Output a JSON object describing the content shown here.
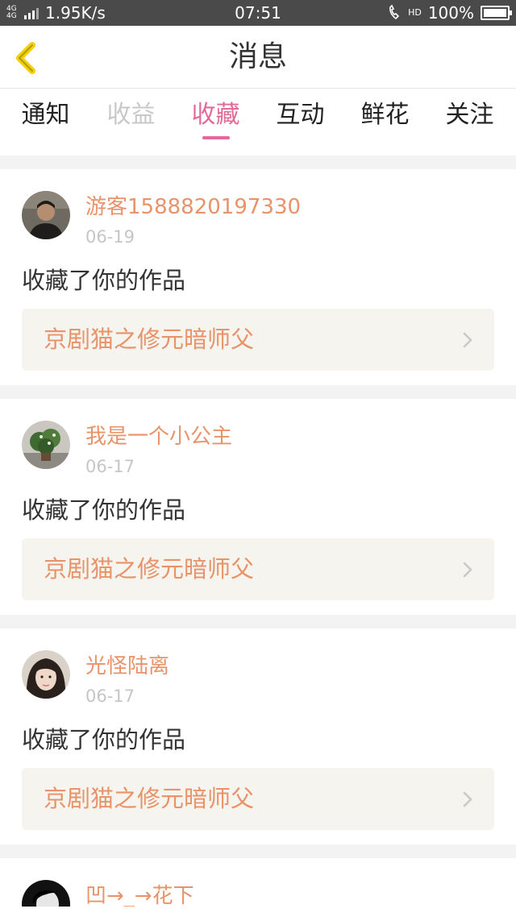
{
  "status_bar": {
    "network_type": "4G 4G",
    "speed": "1.95K/s",
    "time": "07:51",
    "hd_call": "HD",
    "battery": "100%"
  },
  "header": {
    "title": "消息"
  },
  "tabs": [
    {
      "label": "通知",
      "state": "normal"
    },
    {
      "label": "收益",
      "state": "muted"
    },
    {
      "label": "收藏",
      "state": "active"
    },
    {
      "label": "互动",
      "state": "normal"
    },
    {
      "label": "鲜花",
      "state": "normal"
    },
    {
      "label": "关注",
      "state": "normal"
    }
  ],
  "items": [
    {
      "username": "游客1588820197330",
      "date": "06-19",
      "action": "收藏了你的作品",
      "work": "京剧猫之修元暗师父",
      "avatar": "man-dark"
    },
    {
      "username": "我是一个小公主",
      "date": "06-17",
      "action": "收藏了你的作品",
      "work": "京剧猫之修元暗师父",
      "avatar": "plant"
    },
    {
      "username": "光怪陆离",
      "date": "06-17",
      "action": "收藏了你的作品",
      "work": "京剧猫之修元暗师父",
      "avatar": "girl"
    },
    {
      "username": "凹→_→花下",
      "avatar": "bw-portrait"
    }
  ],
  "colors": {
    "accent_pink": "#e26a9a",
    "name_orange": "#e8936a",
    "back_arrow": "#f4d000"
  }
}
